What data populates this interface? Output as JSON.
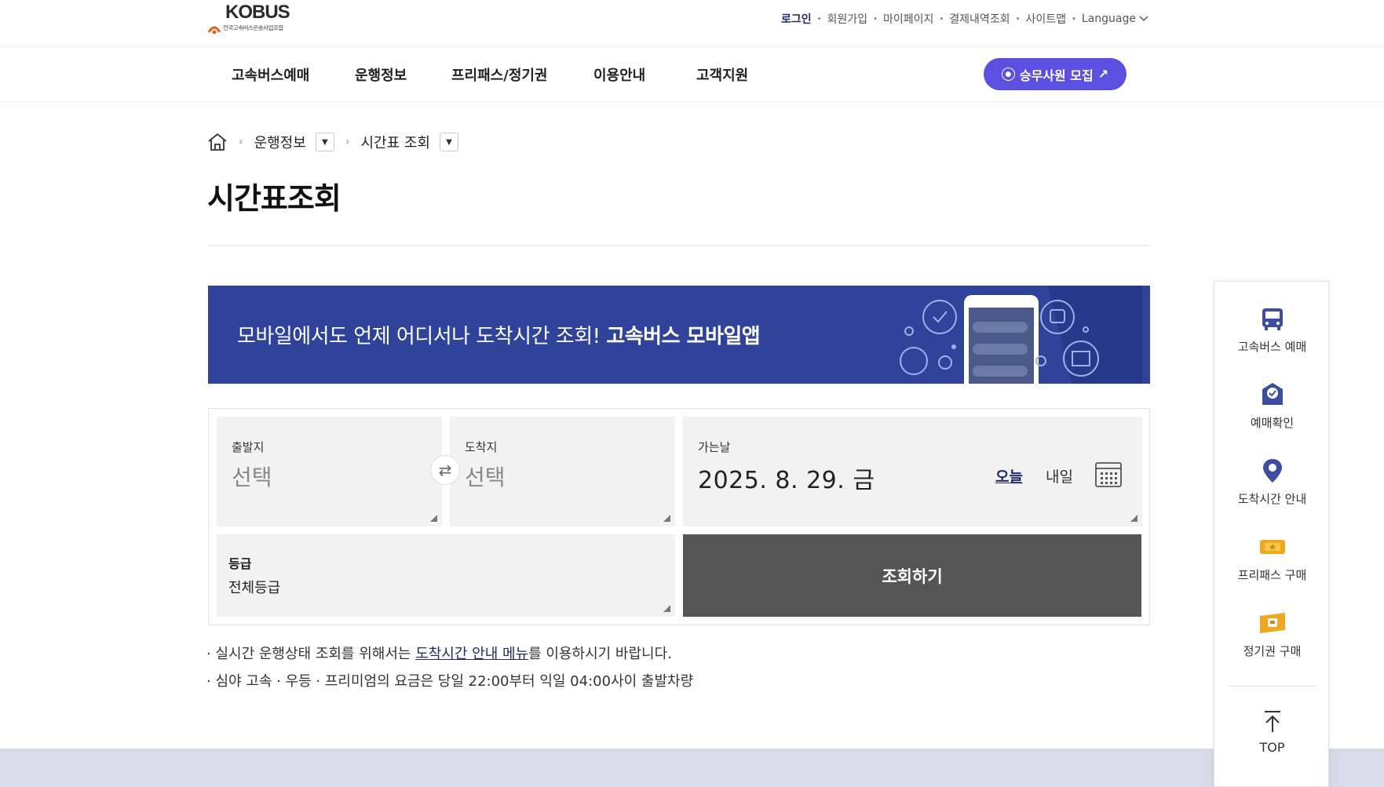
{
  "header": {
    "logo_text": "KOBUS",
    "logo_sub": "전국고속버스운송사업조합",
    "util_links": [
      "로그인",
      "회원가입",
      "마이페이지",
      "결제내역조회",
      "사이트맵",
      "Language"
    ]
  },
  "gnb": {
    "items": [
      "고속버스예매",
      "운행정보",
      "프리패스/정기권",
      "이용안내",
      "고객지원"
    ],
    "crew_button": "승무사원 모집"
  },
  "breadcrumb": {
    "level1": "운행정보",
    "level2": "시간표 조회"
  },
  "page_title": "시간표조회",
  "banner": {
    "text": "모바일에서도 언제 어디서나 도착시간 조회!",
    "text_bold": "고속버스 모바일앱"
  },
  "form": {
    "departure_label": "출발지",
    "departure_value": "선택",
    "arrival_label": "도착지",
    "arrival_value": "선택",
    "date_label": "가는날",
    "date_value": "2025. 8. 29. 금",
    "today": "오늘",
    "tomorrow": "내일",
    "grade_label": "등급",
    "grade_value": "전체등급",
    "search_button": "조회하기"
  },
  "notes": {
    "line1_pre": "실시간 운행상태 조회를 위해서는 ",
    "line1_link": "도착시간 안내 메뉴",
    "line1_post": "를 이용하시기 바랍니다.",
    "line2": "심야 고속 · 우등 · 프리미엄의 요금은 당일 22:00부터 익일 04:00사이 출발차량"
  },
  "quick_menu": {
    "items": [
      "고속버스 예매",
      "예매확인",
      "도착시간 안내",
      "프리패스 구매",
      "정기권 구매"
    ],
    "top": "TOP"
  },
  "colors": {
    "brand_navy": "#2f439a",
    "crew_purple": "#5a4fe0",
    "search_gray": "#555555",
    "footer_band": "#d6dbe5"
  }
}
